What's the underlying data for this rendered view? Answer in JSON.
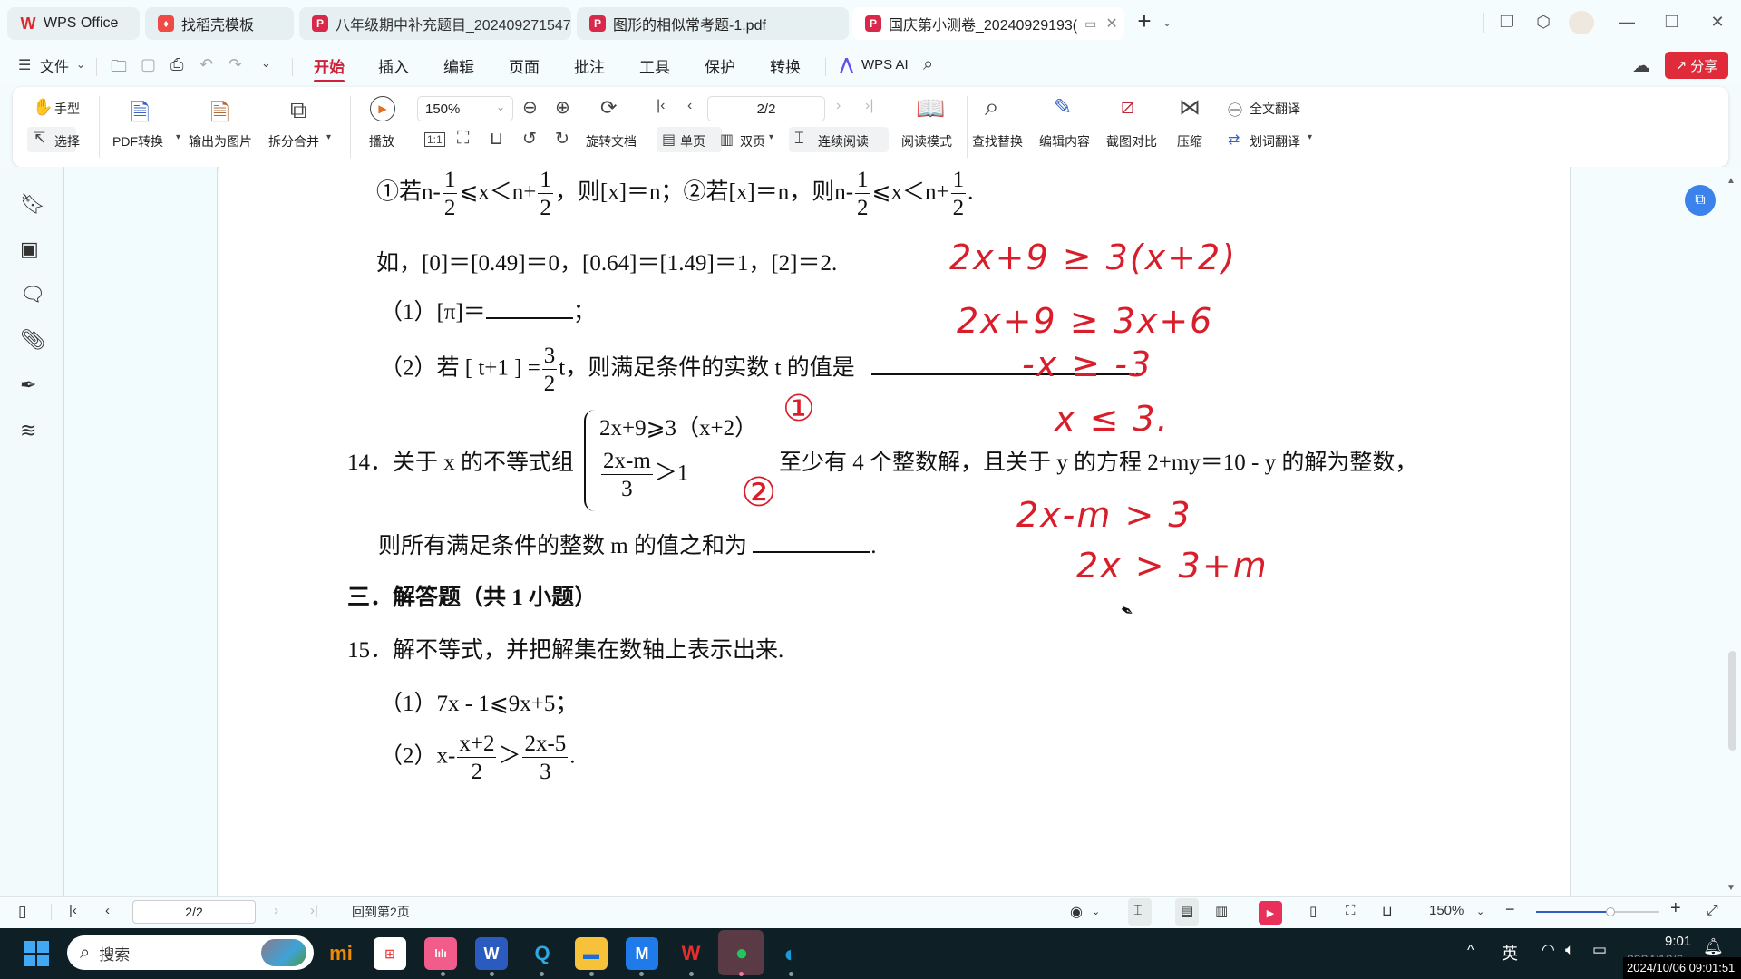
{
  "tabs": [
    {
      "label": "WPS Office",
      "icon": "wps-logo-icon",
      "color": "#e0262f"
    },
    {
      "label": "找稻壳模板",
      "icon": "docer-icon",
      "color": "#f04a47"
    },
    {
      "label": "八年级期中补充题目_202409271547",
      "icon": "pdf-icon",
      "color": "#d8294a"
    },
    {
      "label": "图形的相似常考题-1.pdf",
      "icon": "pdf-icon",
      "color": "#d8294a"
    },
    {
      "label": "国庆第小测卷_20240929193(",
      "icon": "pdf-icon",
      "color": "#d8294a",
      "active": true
    }
  ],
  "menu": {
    "file": "文件",
    "items": [
      "开始",
      "插入",
      "编辑",
      "页面",
      "批注",
      "工具",
      "保护",
      "转换"
    ],
    "active": "开始",
    "wps_ai": "WPS AI",
    "share": "分享"
  },
  "ribbon": {
    "hand": "手型",
    "select": "选择",
    "pdf_convert": "PDF转换",
    "export_image": "输出为图片",
    "split_merge": "拆分合并",
    "play": "播放",
    "zoom_value": "150%",
    "rotate_doc": "旋转文档",
    "page_value": "2/2",
    "single_page": "单页",
    "double_page": "双页",
    "continuous": "连续阅读",
    "read_mode": "阅读模式",
    "find_replace": "查找替换",
    "edit_content": "编辑内容",
    "screenshot_compare": "截图对比",
    "compress": "压缩",
    "full_translate": "全文翻译",
    "word_translate": "划词翻译",
    "fit_label": "1:1"
  },
  "document": {
    "line1": {
      "c1": "①若",
      "n": "n-",
      "one": "1",
      "two": "2",
      "le": "⩽x＜n+",
      "then1": "，则[x]＝n；②若[x]＝n，则"
    },
    "example": "如，[0]＝[0.49]＝0，[0.64]＝[1.49]＝1，[2]＝2.",
    "q13_1": "（1）[π]＝",
    "q13_1_end": "；",
    "q13_2_pre": "（2）若 [ t+1 ] =",
    "q13_2_num": "3",
    "q13_2_den": "2",
    "q13_2_post": "t，则满足条件的实数 t 的值是",
    "period": ".",
    "q14_pre": "14．关于 x 的不等式组",
    "q14_eq1": "2x+9⩾3（x+2）",
    "q14_eq2_num": "2x-m",
    "q14_eq2_den": "3",
    "q14_eq2_rhs": "＞1",
    "q14_post": "至少有 4 个整数解，且关于 y 的方程 2+my＝10 - y 的解为整数，",
    "q14_line2": "则所有满足条件的整数 m 的值之和为",
    "section3": "三．解答题（共 1 小题）",
    "q15": "15．解不等式，并把解集在数轴上表示出来.",
    "q15_1": "（1）7x - 1⩽9x+5；",
    "q15_2_pre": "（2）",
    "q15_2_x": "x-",
    "q15_2_n1": "x+2",
    "q15_2_d1": "2",
    "q15_2_gt": "＞",
    "q15_2_n2": "2x-5",
    "q15_2_d2": "3"
  },
  "handwriting": {
    "color": "#d81e2a",
    "lines": [
      "2x+9 ≥ 3(x+2)",
      "2x+9 ≥ 3x+6",
      "-x ≥ -3",
      "x ≤ 3.",
      "2x-m > 3",
      "2x > 3+m"
    ],
    "marks": [
      "①",
      "②"
    ]
  },
  "statusbar": {
    "page_value": "2/2",
    "back_to_page": "回到第2页",
    "zoom": "150%",
    "zoom_fraction": 0.6
  },
  "taskbar": {
    "search_placeholder": "搜索",
    "tray_lang": "英",
    "time": "9:01",
    "date": "2024/10/6",
    "timestamp_overlay": "2024/10/06 09:01:51"
  }
}
